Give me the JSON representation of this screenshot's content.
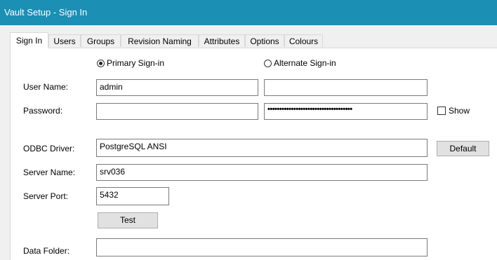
{
  "window": {
    "title": "Vault Setup - Sign In"
  },
  "tabs": [
    {
      "label": "Sign In"
    },
    {
      "label": "Users"
    },
    {
      "label": "Groups"
    },
    {
      "label": "Revision Naming"
    },
    {
      "label": "Attributes"
    },
    {
      "label": "Options"
    },
    {
      "label": "Colours"
    }
  ],
  "signin": {
    "primary_label": "Primary Sign-in",
    "alternate_label": "Alternate Sign-in",
    "selected": "primary"
  },
  "labels": {
    "user_name": "User Name:",
    "password": "Password:",
    "odbc_driver": "ODBC Driver:",
    "server_name": "Server Name:",
    "server_port": "Server Port:",
    "data_folder": "Data Folder:"
  },
  "fields": {
    "primary_user": "admin",
    "alternate_user": "",
    "primary_password": "",
    "alternate_password": "••••••••••••••••••••••••••••••••••••",
    "odbc_driver": "PostgreSQL ANSI",
    "server_name": "srv036",
    "server_port": "5432",
    "data_folder": ""
  },
  "show_label": "Show",
  "buttons": {
    "default": "Default",
    "test": "Test"
  }
}
